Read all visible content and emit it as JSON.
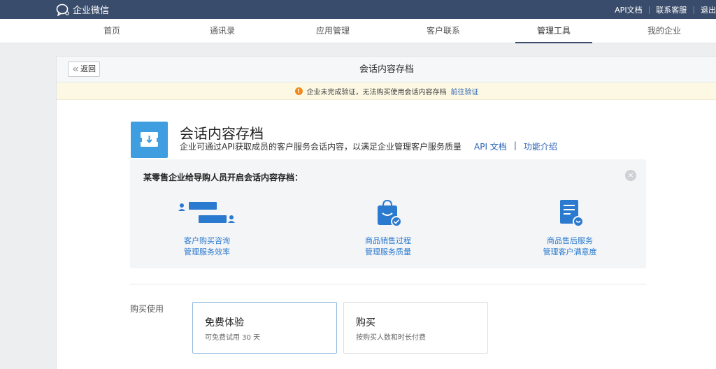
{
  "topbar": {
    "brand": "企业微信",
    "links": [
      "API文档",
      "联系客服",
      "退出"
    ]
  },
  "nav": {
    "tabs": [
      "首页",
      "通讯录",
      "应用管理",
      "客户联系",
      "管理工具",
      "我的企业"
    ],
    "active": "管理工具"
  },
  "panel": {
    "back_label": "返回",
    "title": "会话内容存档"
  },
  "warning": {
    "text": "企业未完成验证，无法购买使用会话内容存档",
    "link": "前往验证"
  },
  "feature": {
    "title": "会话内容存档",
    "description": "企业可通过API获取成员的客户服务会话内容，以满足企业管理客户服务质量",
    "link_api": "API 文档",
    "separator": "|",
    "link_intro": "功能介绍"
  },
  "demo": {
    "title": "某零售企业给导购人员开启会话内容存档：",
    "close_icon": "close-circle-icon",
    "scenarios": [
      {
        "icon": "chat-bubbles-icon",
        "line1": "客户购买咨询",
        "line2": "管理服务效率"
      },
      {
        "icon": "shopping-bag-check-icon",
        "line1": "商品销售过程",
        "line2": "管理服务质量"
      },
      {
        "icon": "document-smile-icon",
        "line1": "商品售后服务",
        "line2": "管理客户满意度"
      }
    ]
  },
  "purchase": {
    "label": "购买使用",
    "plans": [
      {
        "name": "免费体验",
        "desc": "可免费试用 30 天"
      },
      {
        "name": "购买",
        "desc": "按购买人数和时长付费"
      }
    ]
  },
  "colors": {
    "topbar": "#3a4c6b",
    "accent_blue": "#3f9ee0",
    "link_blue": "#2a62b5",
    "warn_bg": "#fcf8e3",
    "warn_icon": "#f0891c"
  }
}
